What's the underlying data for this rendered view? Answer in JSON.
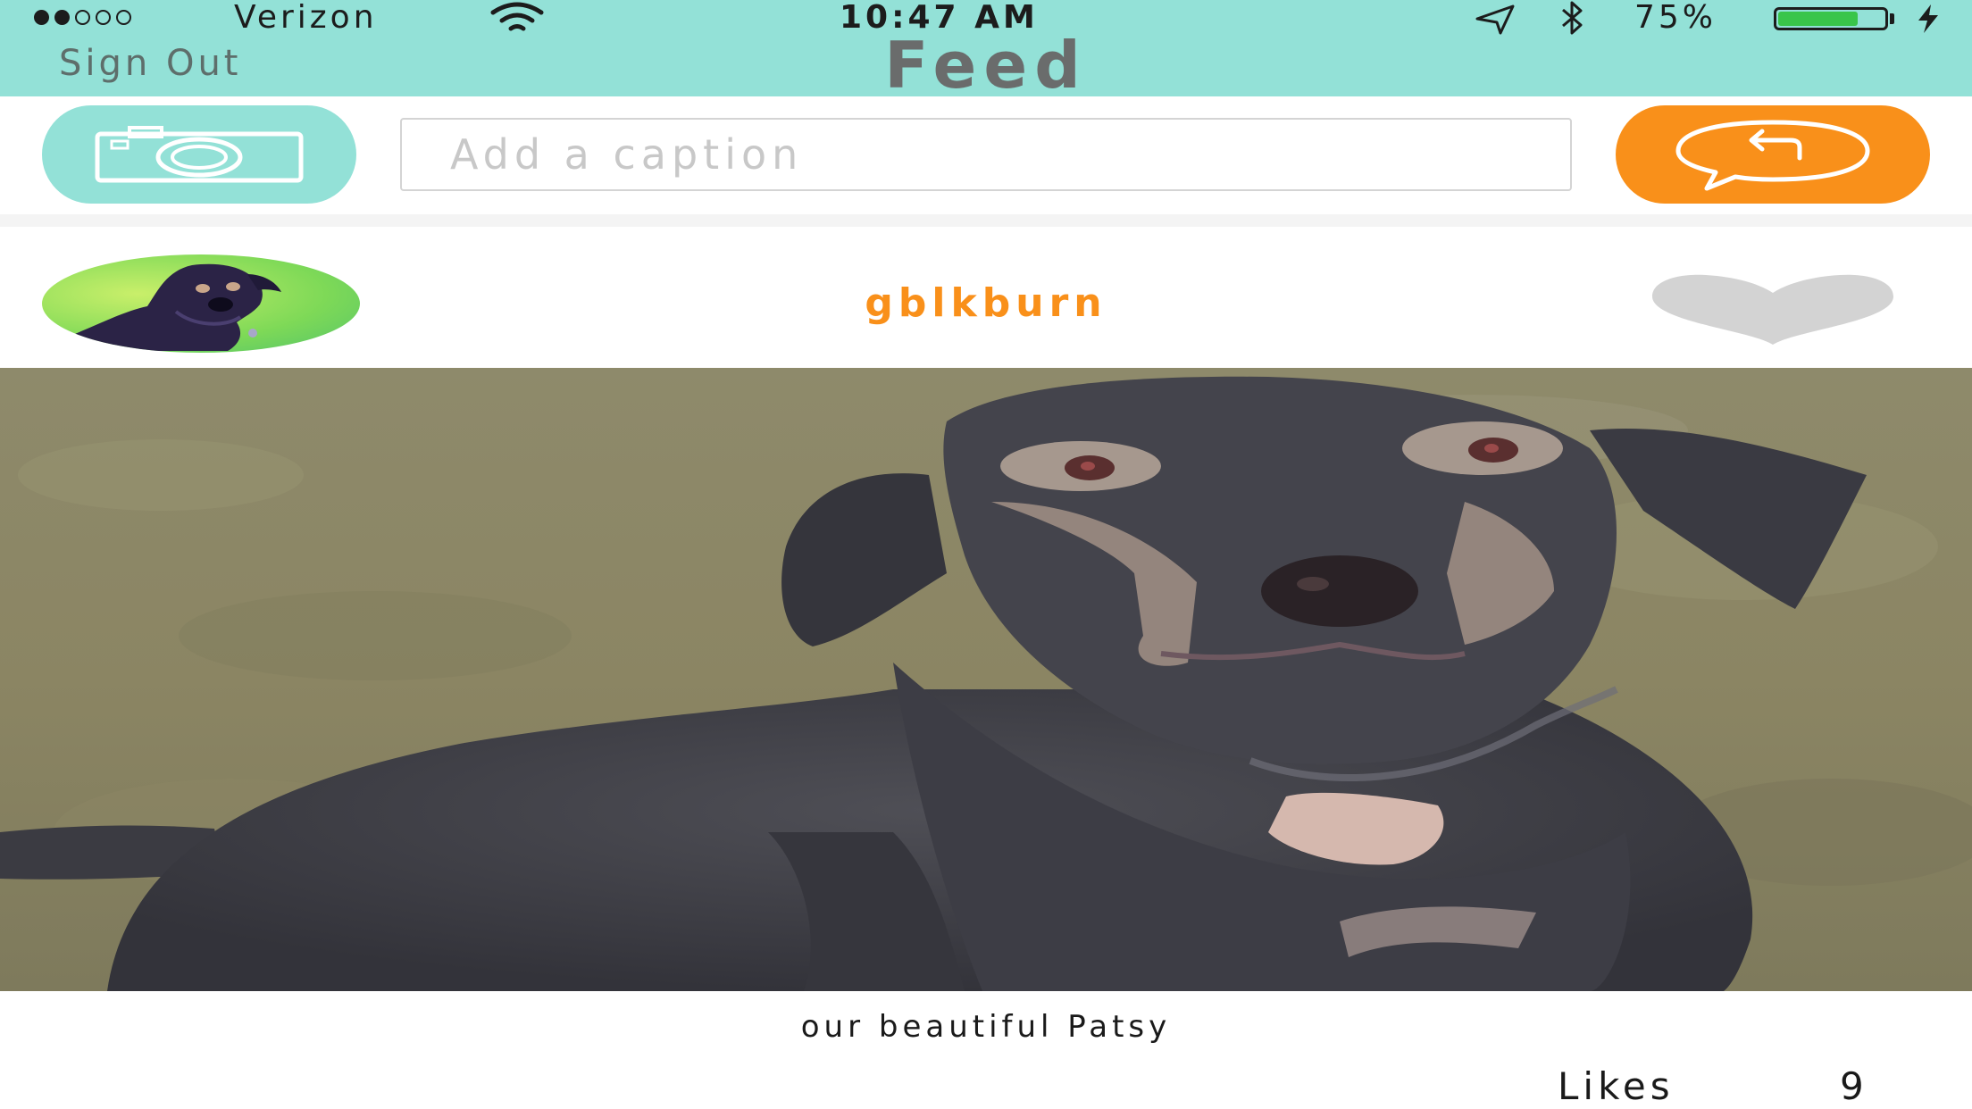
{
  "status_bar": {
    "signal_bars": 2,
    "signal_total": 5,
    "carrier": "Verizon",
    "time": "10:47 AM",
    "battery_percent_label": "75%",
    "battery_level": 0.75,
    "icons": [
      "wifi-icon",
      "location-arrow-icon",
      "bluetooth-icon",
      "charging-bolt-icon"
    ]
  },
  "nav": {
    "sign_out_label": "Sign Out",
    "title": "Feed"
  },
  "compose": {
    "caption_placeholder": "Add a caption",
    "caption_value": "",
    "camera_icon": "camera-icon",
    "post_icon": "speech-bubble-reply-icon"
  },
  "post": {
    "username": "gblkburn",
    "caption": "our beautiful Patsy",
    "likes_label": "Likes",
    "likes_count": "9",
    "liked": false,
    "like_icon": "heart-icon"
  },
  "colors": {
    "teal": "#93e1d7",
    "orange": "#f9901a",
    "heart_inactive": "#d3d3d3",
    "title_gray": "#6a6c6c"
  }
}
